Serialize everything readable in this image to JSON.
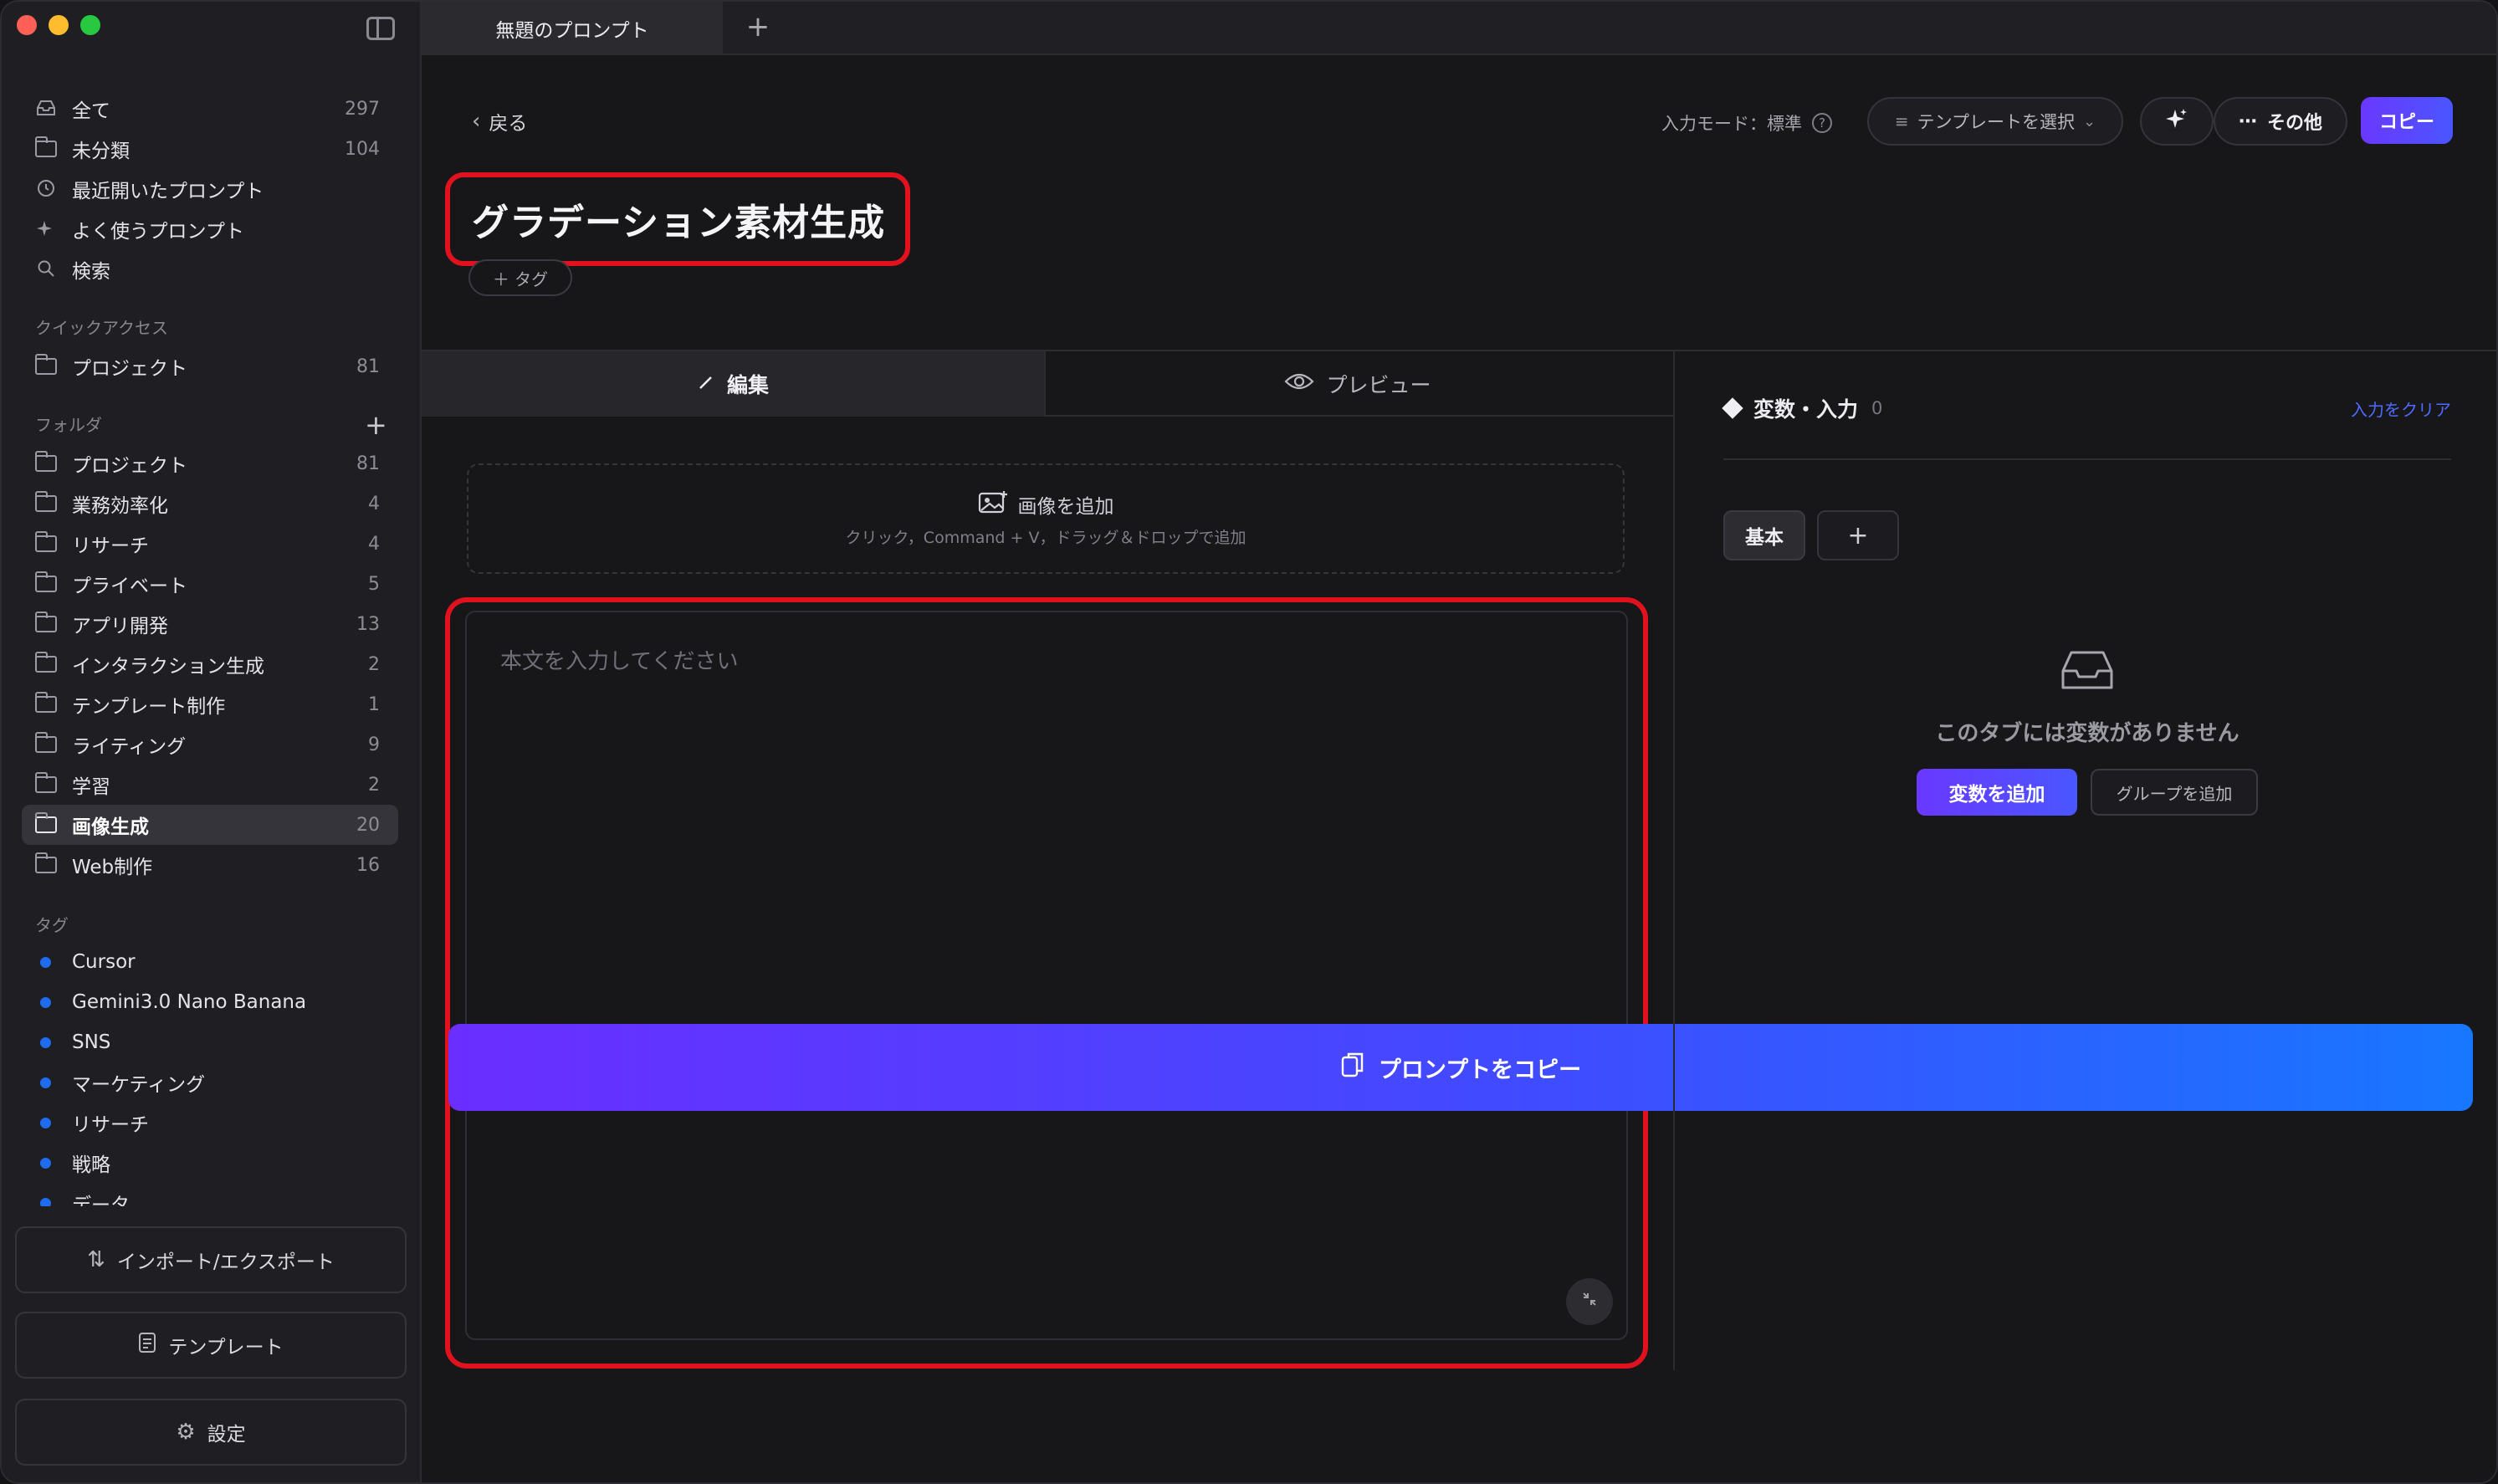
{
  "sidebar": {
    "main_items": [
      {
        "label": "全て",
        "count": "297",
        "icon": "inbox-icon"
      },
      {
        "label": "未分類",
        "count": "104",
        "icon": "folder-icon"
      },
      {
        "label": "最近開いたプロンプト",
        "count": "",
        "icon": "clock-icon"
      },
      {
        "label": "よく使うプロンプト",
        "count": "",
        "icon": "sparkle-icon"
      },
      {
        "label": "検索",
        "count": "",
        "icon": "search-icon"
      }
    ],
    "quick_access_label": "クイックアクセス",
    "quick_access": [
      {
        "label": "プロジェクト",
        "count": "81"
      }
    ],
    "folders_label": "フォルダ",
    "folders": [
      {
        "label": "プロジェクト",
        "count": "81"
      },
      {
        "label": "業務効率化",
        "count": "4"
      },
      {
        "label": "リサーチ",
        "count": "4"
      },
      {
        "label": "プライベート",
        "count": "5"
      },
      {
        "label": "アプリ開発",
        "count": "13"
      },
      {
        "label": "インタラクション生成",
        "count": "2"
      },
      {
        "label": "テンプレート制作",
        "count": "1"
      },
      {
        "label": "ライティング",
        "count": "9"
      },
      {
        "label": "学習",
        "count": "2"
      },
      {
        "label": "画像生成",
        "count": "20"
      },
      {
        "label": "Web制作",
        "count": "16"
      }
    ],
    "active_folder": "画像生成",
    "tags_label": "タグ",
    "tags": [
      "Cursor",
      "Gemini3.0 Nano Banana",
      "SNS",
      "マーケティング",
      "リサーチ",
      "戦略",
      "データ"
    ],
    "tag_color": "#1e6cf0",
    "import_export_label": "インポート/エクスポート",
    "template_label": "テンプレート",
    "settings_label": "設定"
  },
  "tabbar": {
    "active_tab": "無題のプロンプト",
    "new_tab_symbol": "+"
  },
  "header": {
    "back_label": "戻る",
    "input_mode_label": "入力モード：標準",
    "template_select_label": "テンプレートを選択",
    "more_label": "その他",
    "copy_label": "コピー"
  },
  "prompt": {
    "title": "グラデーション素材生成",
    "tag_button_label": "＋ タグ"
  },
  "editor": {
    "tab_edit": "編集",
    "tab_preview": "プレビュー",
    "add_image_label": "画像を追加",
    "add_image_hint": "クリック，Command + V，ドラッグ＆ドロップで追加",
    "body_placeholder": "本文を入力してください",
    "copy_prompt_label": "プロンプトをコピー"
  },
  "variables": {
    "title": "変数・入力",
    "count": "0",
    "clear_label": "入力をクリア",
    "group_tab": "基本",
    "add_group_tab": "+",
    "empty_message": "このタブには変数がありません",
    "add_variable_label": "変数を追加",
    "add_group_label": "グループを追加"
  },
  "colors": {
    "accent": "#5a45ff",
    "highlight_border": "#e1121d",
    "background": "#17171a"
  }
}
